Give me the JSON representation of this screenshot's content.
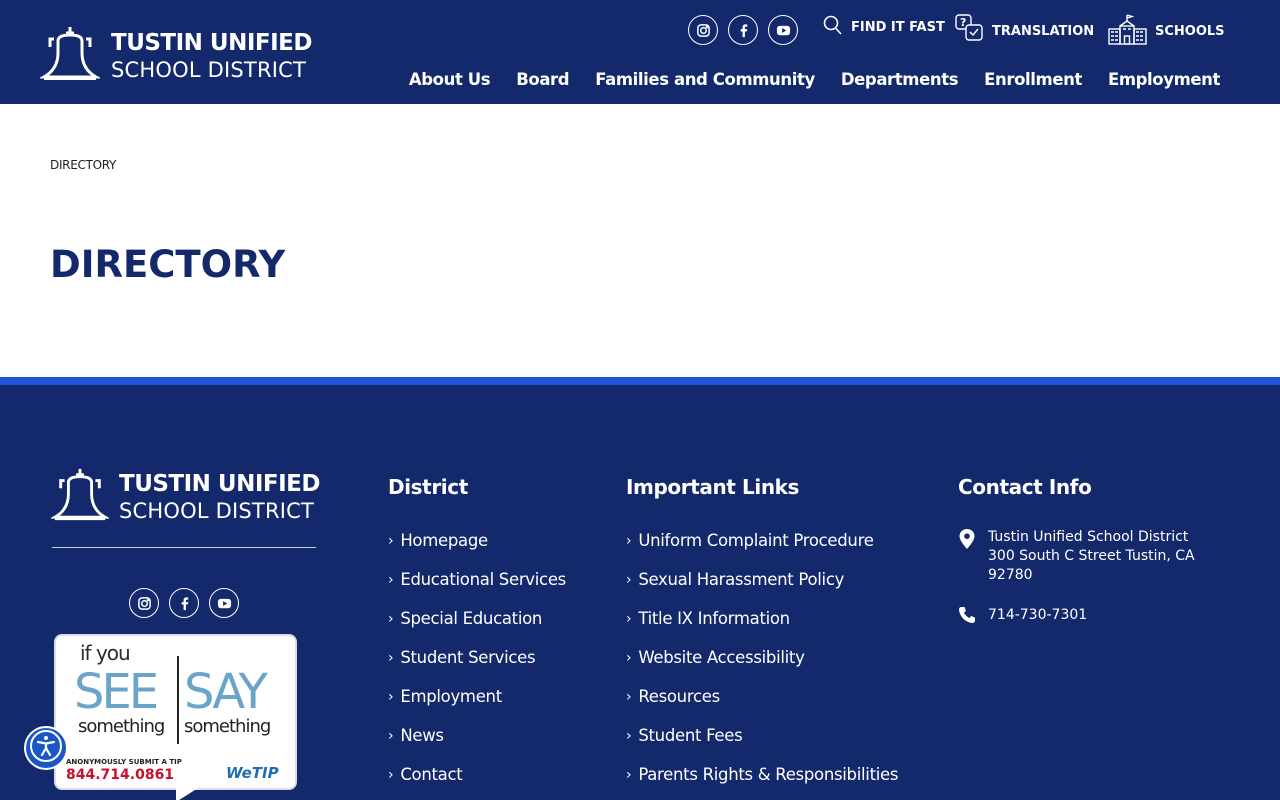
{
  "header": {
    "logo_line1": "TUSTIN UNIFIED",
    "logo_line2": "SCHOOL DISTRICT",
    "utility": {
      "find": "FIND IT FAST",
      "translation": "TRANSLATION",
      "schools": "SCHOOLS"
    },
    "nav": [
      "About Us",
      "Board",
      "Families and Community",
      "Departments",
      "Enrollment",
      "Employment"
    ]
  },
  "main": {
    "breadcrumb": "DIRECTORY",
    "title": "DIRECTORY"
  },
  "footer": {
    "logo_line1": "TUSTIN UNIFIED",
    "logo_line2": "SCHOOL DISTRICT",
    "district_title": "District",
    "district_links": [
      "Homepage",
      "Educational Services",
      "Special Education",
      "Student Services",
      "Employment",
      "News",
      "Contact"
    ],
    "links_title": "Important Links",
    "important_links": [
      "Uniform Complaint Procedure",
      "Sexual Harassment Policy",
      "Title IX Information",
      "Website Accessibility",
      "Resources",
      "Student Fees",
      "Parents Rights & Responsibilities"
    ],
    "contact_title": "Contact Info",
    "address_line1": "Tustin Unified School District",
    "address_line2": "300 South C Street Tustin, CA",
    "address_line3": "92780",
    "phone": "714-730-7301",
    "badge": {
      "if_you": "if you",
      "see": "SEE",
      "say": "SAY",
      "something1": "something",
      "something2": "something",
      "anon": "ANONYMOUSLY SUBMIT A TIP",
      "phone": "844.714.0861",
      "brand": "WeTIP"
    }
  },
  "colors": {
    "navy": "#13296b",
    "accent_blue": "#1f54d6",
    "white": "#ffffff"
  }
}
